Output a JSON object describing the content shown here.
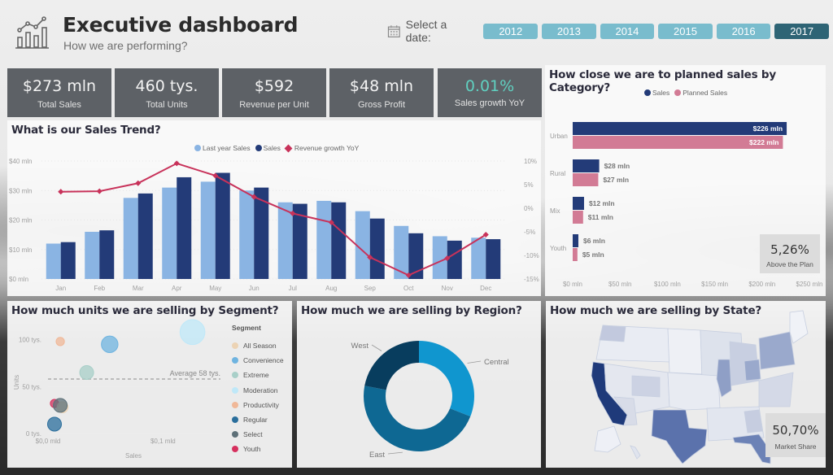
{
  "header": {
    "title": "Executive dashboard",
    "subtitle": "How we are performing?",
    "logo_icon": "bar-line-chart-icon",
    "date_label": "Select a date:",
    "date_icon": "calendar-icon",
    "years": [
      "2012",
      "2013",
      "2014",
      "2015",
      "2016",
      "2017"
    ],
    "selected_year": "2017",
    "button_color": "#79bccd",
    "selected_color": "#2e6475"
  },
  "kpis": [
    {
      "value": "$273 mln",
      "label": "Total Sales"
    },
    {
      "value": "460 tys.",
      "label": "Total Units"
    },
    {
      "value": "$592",
      "label": "Revenue per Unit"
    },
    {
      "value": "$48 mln",
      "label": "Gross Profit"
    },
    {
      "value": "0.01%",
      "label": "Sales growth YoY",
      "color": "#60d0c0"
    }
  ],
  "panels": {
    "trend_title": "What is our Sales Trend?",
    "category_title": "How close we are to planned sales by Category?",
    "segment_title": "How much units we are selling by Segment?",
    "region_title": "How much we are selling by Region?",
    "state_title": "How much we are selling by State?"
  },
  "cards": {
    "above_plan": {
      "value": "5,26%",
      "label": "Above the Plan"
    },
    "market_share": {
      "value": "50,70%",
      "label": "Market Share"
    }
  },
  "chart_data": [
    {
      "type": "bar",
      "title": "What is our Sales Trend?",
      "categories": [
        "Jan",
        "Feb",
        "Mar",
        "Apr",
        "May",
        "Jun",
        "Jul",
        "Aug",
        "Sep",
        "Oct",
        "Nov",
        "Dec"
      ],
      "series": [
        {
          "name": "Last year Sales",
          "color": "#8ab4e3",
          "values": [
            12,
            16,
            27.5,
            31,
            33,
            30,
            26,
            26.5,
            23,
            18,
            14.5,
            14
          ]
        },
        {
          "name": "Sales",
          "color": "#233b78",
          "values": [
            12.5,
            16.5,
            29,
            34.5,
            36,
            31,
            25.5,
            26,
            20.5,
            15.5,
            13,
            13.5
          ]
        },
        {
          "name": "Revenue growth YoY",
          "type": "line",
          "axis": "right",
          "color": "#c8325a",
          "values": [
            3.5,
            3.6,
            5.3,
            9.5,
            6.9,
            2.4,
            -1.1,
            -3.0,
            -10.4,
            -14.2,
            -10.6,
            -5.6
          ]
        }
      ],
      "left_ticks": [
        "$0 mln",
        "$10 mln",
        "$20 mln",
        "$30 mln",
        "$40 mln"
      ],
      "right_ticks": [
        "-15%",
        "-10%",
        "-5%",
        "0%",
        "5%",
        "10%"
      ],
      "ylim": [
        0,
        40
      ],
      "y2lim": [
        -15,
        10
      ],
      "legend": "top-center"
    },
    {
      "type": "bar",
      "orientation": "horizontal",
      "title": "How close we are to planned sales by Category?",
      "categories": [
        "Urban",
        "Rural",
        "Mix",
        "Youth"
      ],
      "series": [
        {
          "name": "Sales",
          "color": "#233b78",
          "values": [
            226,
            28,
            12,
            6
          ],
          "labels": [
            "$226 mln",
            "$28 mln",
            "$12 mln",
            "$6 mln"
          ]
        },
        {
          "name": "Planned Sales",
          "color": "#d27b95",
          "values": [
            222,
            27,
            11,
            5
          ],
          "labels": [
            "$222 mln",
            "$27 mln",
            "$11 mln",
            "$5 mln"
          ]
        }
      ],
      "x_ticks": [
        "$0 mln",
        "$50 mln",
        "$100 mln",
        "$150 mln",
        "$200 mln",
        "$250 mln"
      ],
      "xlim": [
        0,
        250
      ],
      "legend": "top-center"
    },
    {
      "type": "scatter",
      "title": "How much units we are selling by Segment?",
      "xlabel": "Sales",
      "ylabel": "Units",
      "x_ticks": [
        "$0,0 mld",
        "$0,1 mld"
      ],
      "y_ticks": [
        "0 tys.",
        "50 tys.",
        "100 tys."
      ],
      "xlim": [
        0,
        0.15
      ],
      "ylim": [
        0,
        110
      ],
      "reference_line": {
        "label": "Average 58 tys.",
        "value": 58
      },
      "legend_title": "Segment",
      "points": [
        {
          "name": "All Season",
          "color": "#ecd3b4",
          "x": 0.007,
          "y": 28,
          "size": 4
        },
        {
          "name": "Convenience",
          "color": "#6fb4e0",
          "x": 0.048,
          "y": 95,
          "size": 6
        },
        {
          "name": "Extreme",
          "color": "#a8cfc8",
          "x": 0.028,
          "y": 65,
          "size": 5
        },
        {
          "name": "Moderation",
          "color": "#bfe8f8",
          "x": 0.12,
          "y": 108,
          "size": 9
        },
        {
          "name": "Productivity",
          "color": "#f0b898",
          "x": 0.005,
          "y": 98,
          "size": 3
        },
        {
          "name": "Regular",
          "color": "#2a6e9c",
          "x": 0.0,
          "y": 10,
          "size": 5
        },
        {
          "name": "Select",
          "color": "#5d7078",
          "x": 0.005,
          "y": 30,
          "size": 5
        },
        {
          "name": "Youth",
          "color": "#d6305e",
          "x": 0.0,
          "y": 32,
          "size": 3
        }
      ],
      "legend": "right"
    },
    {
      "type": "pie",
      "title": "How much we are selling by Region?",
      "donut": true,
      "slices": [
        {
          "name": "Central",
          "value": 31,
          "color": "#1096cf"
        },
        {
          "name": "East",
          "value": 47,
          "color": "#0e6893"
        },
        {
          "name": "West",
          "value": 22,
          "color": "#083d5e"
        }
      ]
    }
  ],
  "map": {
    "title": "How much we are selling by State?",
    "high_states": [
      "California",
      "Texas",
      "Florida",
      "New York",
      "Illinois",
      "Ohio",
      "Pennsylvania"
    ],
    "colors": {
      "max": "#1f3a7a",
      "high": "#5b72ac",
      "mid": "#a8b4d4",
      "low": "#e6e9f1"
    }
  }
}
